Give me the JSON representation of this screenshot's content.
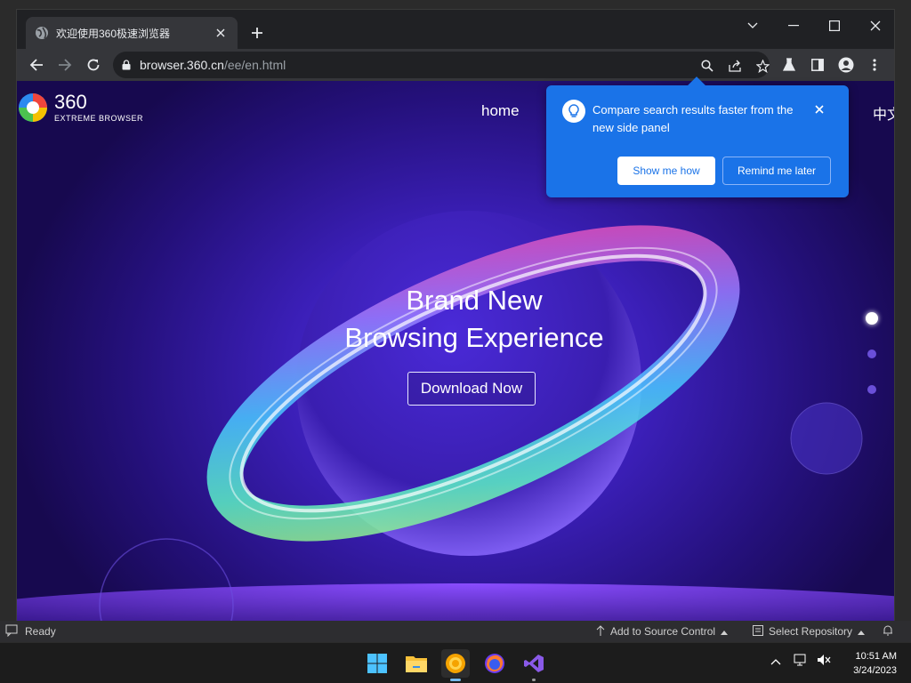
{
  "browser": {
    "tab": {
      "title": "欢迎使用360极速浏览器"
    },
    "omnibox": {
      "host": "browser.360.cn",
      "path": "/ee/en.html"
    }
  },
  "page": {
    "logo": {
      "number": "360",
      "subtitle": "EXTREME BROWSER"
    },
    "nav": {
      "home": "home",
      "lang": "中文"
    },
    "hero": {
      "line1": "Brand New",
      "line2": "Browsing Experience",
      "download_label": "Download Now"
    }
  },
  "popup": {
    "message": "Compare search results faster from the new side panel",
    "show_label": "Show me how",
    "remind_label": "Remind me later"
  },
  "ide_status": {
    "ready": "Ready",
    "source_control": "Add to Source Control",
    "repository": "Select Repository"
  },
  "taskbar": {
    "time": "10:51 AM",
    "date": "3/24/2023"
  },
  "colors": {
    "popup_blue": "#1a73e8",
    "page_bg": "#24107a",
    "taskbar": "#1c1c1c"
  }
}
